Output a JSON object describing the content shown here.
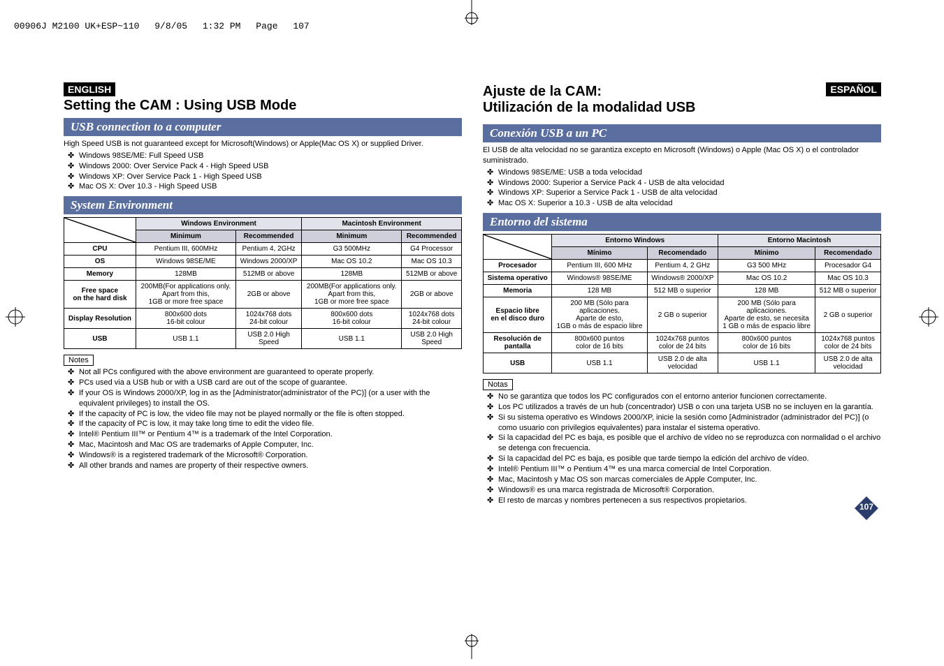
{
  "print_header": {
    "doc_id": "00906J M2100 UK+ESP~110",
    "date": "9/8/05",
    "time": "1:32 PM",
    "page_label": "Page",
    "page_no": "107"
  },
  "left": {
    "lang": "ENGLISH",
    "title": "Setting the CAM : Using USB Mode",
    "sec1": "USB connection to a computer",
    "intro": "High Speed USB is not guaranteed except for Microsoft(Windows) or Apple(Mac OS X) or supplied Driver.",
    "intro_items": [
      "Windows 98SE/ME: Full Speed USB",
      "Windows 2000: Over Service Pack 4 - High Speed USB",
      "Windows XP: Over Service Pack 1 - High Speed USB",
      "Mac OS X: Over 10.3 - High Speed USB"
    ],
    "sec2": "System Environment",
    "table": {
      "win_env": "Windows Environment",
      "mac_env": "Macintosh Environment",
      "min": "Minimum",
      "rec": "Recommended",
      "rows": [
        {
          "h": "CPU",
          "a": "Pentium III, 600MHz",
          "b": "Pentium 4, 2GHz",
          "c": "G3 500MHz",
          "d": "G4 Processor"
        },
        {
          "h": "OS",
          "a": "Windows 98SE/ME",
          "b": "Windows 2000/XP",
          "c": "Mac OS 10.2",
          "d": "Mac OS 10.3"
        },
        {
          "h": "Memory",
          "a": "128MB",
          "b": "512MB or above",
          "c": "128MB",
          "d": "512MB or above"
        },
        {
          "h": "Free space\non the hard disk",
          "a": "200MB(For applications only.\nApart from this,\n1GB or more free space",
          "b": "2GB or above",
          "c": "200MB(For applications only.\nApart from this,\n1GB or more free space",
          "d": "2GB or above"
        },
        {
          "h": "Display Resolution",
          "a": "800x600 dots\n16-bit colour",
          "b": "1024x768 dots\n24-bit colour",
          "c": "800x600 dots\n16-bit colour",
          "d": "1024x768 dots\n24-bit colour"
        },
        {
          "h": "USB",
          "a": "USB 1.1",
          "b": "USB 2.0 High\nSpeed",
          "c": "USB 1.1",
          "d": "USB 2.0 High\nSpeed"
        }
      ]
    },
    "notes_label": "Notes",
    "notes": [
      "Not all PCs configured with the above environment are guaranteed to operate properly.",
      "PCs used via a USB hub or with a USB card are out of the scope of guarantee.",
      "If your OS is Windows 2000/XP, log in as the [Administrator(administrator of the PC)] (or a user with the equivalent privileges) to install the OS.",
      "If the capacity of PC is low, the video file may not be played normally or the file is often stopped.",
      "If the capacity of PC is low, it may take long time to edit the video file.",
      "Intel® Pentium III™ or Pentium 4™ is a trademark of the Intel Corporation.",
      "Mac, Macintosh and Mac OS are trademarks of Apple Computer, Inc.",
      "Windows® is a registered trademark of the Microsoft® Corporation.",
      "All other brands and names are property of their respective owners."
    ]
  },
  "right": {
    "lang": "ESPAÑOL",
    "title": "Ajuste de la CAM:\nUtilización de la modalidad USB",
    "sec1": "Conexión USB a un PC",
    "intro": "El USB de alta velocidad no se garantiza excepto en Microsoft (Windows) o Apple (Mac OS X) o el controlador suministrado.",
    "intro_items": [
      "Windows 98SE/ME: USB a toda velocidad",
      "Windows 2000: Superior a Service Pack 4 - USB de alta velocidad",
      "Windows XP: Superior a Service Pack 1 - USB de alta velocidad",
      "Mac OS X: Superior a 10.3 - USB de alta velocidad"
    ],
    "sec2": "Entorno del sistema",
    "table": {
      "win_env": "Entorno Windows",
      "mac_env": "Entorno Macintosh",
      "min": "Mínimo",
      "rec": "Recomendado",
      "rows": [
        {
          "h": "Procesador",
          "a": "Pentium III, 600 MHz",
          "b": "Pentium 4, 2 GHz",
          "c": "G3 500 MHz",
          "d": "Procesador G4"
        },
        {
          "h": "Sistema operativo",
          "a": "Windows® 98SE/ME",
          "b": "Windows® 2000/XP",
          "c": "Mac OS 10.2",
          "d": "Mac OS 10.3"
        },
        {
          "h": "Memoria",
          "a": "128 MB",
          "b": "512 MB o superior",
          "c": "128 MB",
          "d": "512 MB o superior"
        },
        {
          "h": "Espacio libre\nen el disco duro",
          "a": "200 MB (Sólo para\naplicaciones.\nAparte de esto,\n1GB o más de espacio libre",
          "b": "2 GB o superior",
          "c": "200 MB (Sólo para\naplicaciones.\nAparte de esto, se necesita\n1 GB o más de espacio libre",
          "d": "2 GB o superior"
        },
        {
          "h": "Resolución de\npantalla",
          "a": "800x600 puntos\ncolor de 16 bits",
          "b": "1024x768 puntos\ncolor de 24 bits",
          "c": "800x600 puntos\ncolor de 16 bits",
          "d": "1024x768 puntos\ncolor de 24 bits"
        },
        {
          "h": "USB",
          "a": "USB 1.1",
          "b": "USB 2.0 de alta\nvelocidad",
          "c": "USB 1.1",
          "d": "USB 2.0 de alta\nvelocidad"
        }
      ]
    },
    "notes_label": "Notas",
    "notes": [
      "No se garantiza que todos los PC configurados con el entorno anterior funcionen correctamente.",
      "Los PC utilizados a través de un hub (concentrador) USB o con una tarjeta USB no se incluyen en la garantía.",
      "Si su sistema operativo es Windows 2000/XP, inicie la sesión como [Administrador (administrador del PC)] (o como usuario con privilegios equivalentes) para instalar el sistema operativo.",
      "Si la capacidad del PC es baja, es posible que el archivo de vídeo no se reproduzca con normalidad o el archivo se detenga con frecuencia.",
      "Si la capacidad del PC es baja, es posible que tarde tiempo la edición del archivo de vídeo.",
      "Intel® Pentium III™ o Pentium 4™ es una marca comercial de Intel Corporation.",
      "Mac, Macintosh y Mac OS son marcas comerciales de Apple Computer, Inc.",
      "Windows® es una marca registrada de Microsoft® Corporation.",
      "El resto de marcas y nombres pertenecen a sus respectivos propietarios."
    ]
  },
  "page_number": "107"
}
